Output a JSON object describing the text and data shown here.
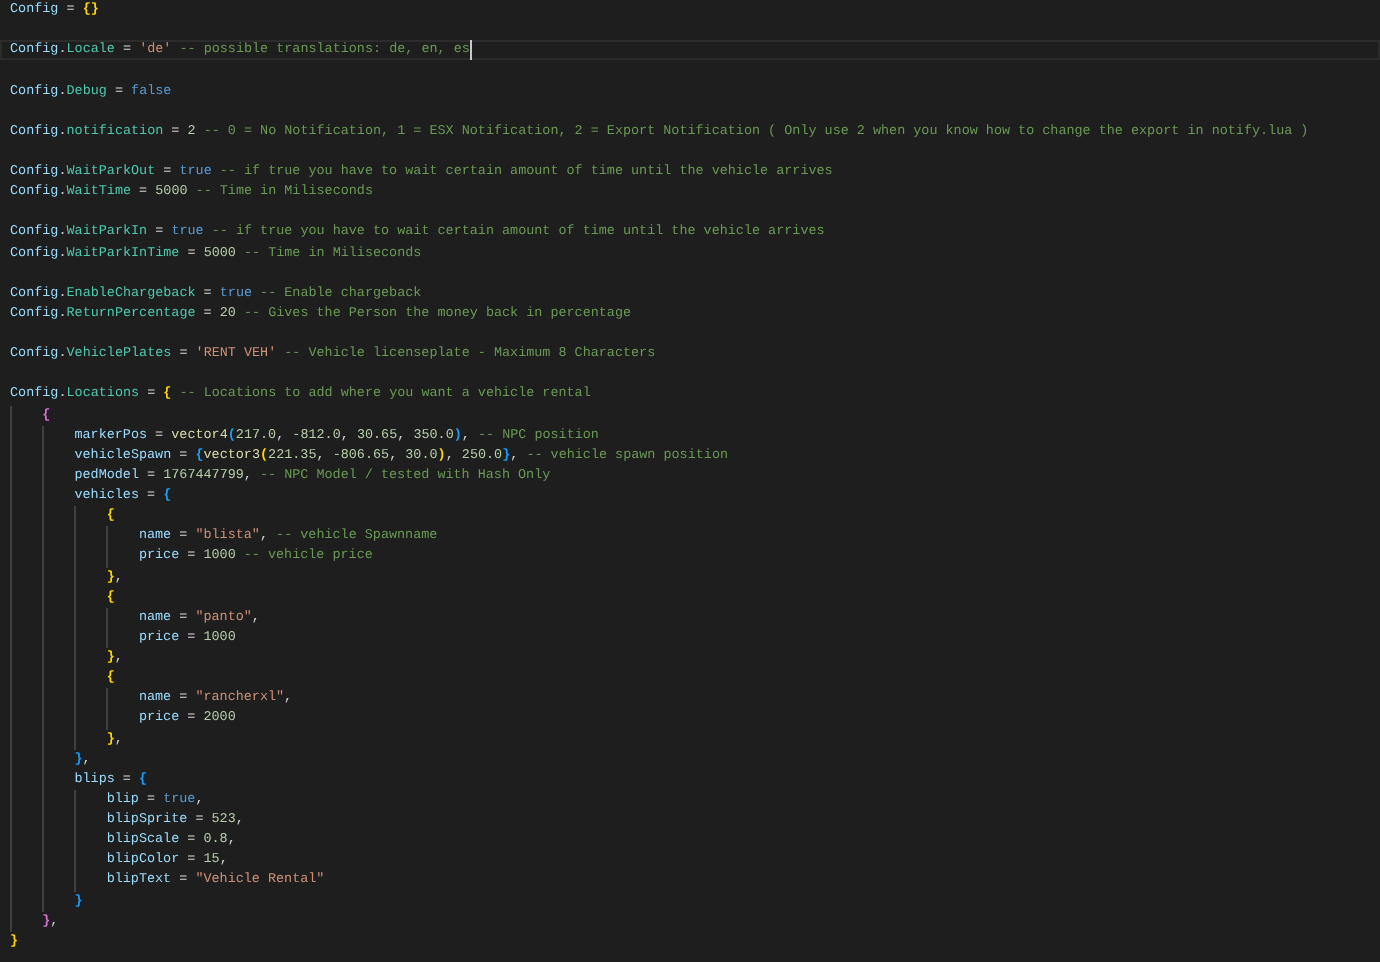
{
  "editor": {
    "lines": [
      {
        "kind": "code",
        "cursor": false,
        "tokens": [
          {
            "kind": "variable",
            "text": "Config"
          },
          {
            "kind": "operator",
            "text": " = "
          },
          {
            "kind": "bracket",
            "text": "{}",
            "color": "#ffd700"
          }
        ]
      },
      {
        "kind": "blank",
        "cursor": false
      },
      {
        "kind": "code",
        "cursor": true,
        "tokens": [
          {
            "kind": "variable",
            "text": "Config"
          },
          {
            "kind": "punctuation",
            "text": "."
          },
          {
            "kind": "field",
            "text": "Locale"
          },
          {
            "kind": "operator",
            "text": " = "
          },
          {
            "kind": "string",
            "text": "'de'"
          },
          {
            "kind": "comment",
            "text": " -- possible translations: de, en, es"
          }
        ]
      },
      {
        "kind": "blank",
        "cursor": false
      },
      {
        "kind": "code",
        "cursor": false,
        "tokens": [
          {
            "kind": "variable",
            "text": "Config"
          },
          {
            "kind": "punctuation",
            "text": "."
          },
          {
            "kind": "field",
            "text": "Debug"
          },
          {
            "kind": "operator",
            "text": " = "
          },
          {
            "kind": "keyword",
            "text": "false"
          }
        ]
      },
      {
        "kind": "blank",
        "cursor": false
      },
      {
        "kind": "code",
        "cursor": false,
        "tokens": [
          {
            "kind": "variable",
            "text": "Config"
          },
          {
            "kind": "punctuation",
            "text": "."
          },
          {
            "kind": "field",
            "text": "notification"
          },
          {
            "kind": "operator",
            "text": " = "
          },
          {
            "kind": "number",
            "text": "2"
          },
          {
            "kind": "comment",
            "text": " -- 0 = No Notification, 1 = ESX Notification, 2 = Export Notification ( Only use 2 when you know how to change the export in notify.lua )"
          }
        ]
      },
      {
        "kind": "blank",
        "cursor": false
      },
      {
        "kind": "code",
        "cursor": false,
        "tokens": [
          {
            "kind": "variable",
            "text": "Config"
          },
          {
            "kind": "punctuation",
            "text": "."
          },
          {
            "kind": "field",
            "text": "WaitParkOut"
          },
          {
            "kind": "operator",
            "text": " = "
          },
          {
            "kind": "keyword",
            "text": "true"
          },
          {
            "kind": "comment",
            "text": " -- if true you have to wait certain amount of time until the vehicle arrives"
          }
        ]
      },
      {
        "kind": "code",
        "cursor": false,
        "tokens": [
          {
            "kind": "variable",
            "text": "Config"
          },
          {
            "kind": "punctuation",
            "text": "."
          },
          {
            "kind": "field",
            "text": "WaitTime"
          },
          {
            "kind": "operator",
            "text": " = "
          },
          {
            "kind": "number",
            "text": "5000"
          },
          {
            "kind": "comment",
            "text": " -- Time in Miliseconds"
          }
        ]
      },
      {
        "kind": "blank",
        "cursor": false
      },
      {
        "kind": "code",
        "cursor": false,
        "tokens": [
          {
            "kind": "variable",
            "text": "Config"
          },
          {
            "kind": "punctuation",
            "text": "."
          },
          {
            "kind": "field",
            "text": "WaitParkIn"
          },
          {
            "kind": "operator",
            "text": " = "
          },
          {
            "kind": "keyword",
            "text": "true"
          },
          {
            "kind": "comment",
            "text": " -- if true you have to wait certain amount of time until the vehicle arrives"
          }
        ]
      },
      {
        "kind": "code",
        "cursor": false,
        "tokens": [
          {
            "kind": "variable",
            "text": "Config"
          },
          {
            "kind": "punctuation",
            "text": "."
          },
          {
            "kind": "field",
            "text": "WaitParkInTime"
          },
          {
            "kind": "operator",
            "text": " = "
          },
          {
            "kind": "number",
            "text": "5000"
          },
          {
            "kind": "comment",
            "text": " -- Time in Miliseconds"
          }
        ]
      },
      {
        "kind": "blank",
        "cursor": false
      },
      {
        "kind": "code",
        "cursor": false,
        "tokens": [
          {
            "kind": "variable",
            "text": "Config"
          },
          {
            "kind": "punctuation",
            "text": "."
          },
          {
            "kind": "field",
            "text": "EnableChargeback"
          },
          {
            "kind": "operator",
            "text": " = "
          },
          {
            "kind": "keyword",
            "text": "true"
          },
          {
            "kind": "comment",
            "text": " -- Enable chargeback"
          }
        ]
      },
      {
        "kind": "code",
        "cursor": false,
        "tokens": [
          {
            "kind": "variable",
            "text": "Config"
          },
          {
            "kind": "punctuation",
            "text": "."
          },
          {
            "kind": "field",
            "text": "ReturnPercentage"
          },
          {
            "kind": "operator",
            "text": " = "
          },
          {
            "kind": "number",
            "text": "20"
          },
          {
            "kind": "comment",
            "text": " -- Gives the Person the money back in percentage"
          }
        ]
      },
      {
        "kind": "blank",
        "cursor": false
      },
      {
        "kind": "code",
        "cursor": false,
        "tokens": [
          {
            "kind": "variable",
            "text": "Config"
          },
          {
            "kind": "punctuation",
            "text": "."
          },
          {
            "kind": "field",
            "text": "VehiclePlates"
          },
          {
            "kind": "operator",
            "text": " = "
          },
          {
            "kind": "string",
            "text": "'RENT VEH'"
          },
          {
            "kind": "comment",
            "text": " -- Vehicle licenseplate - Maximum 8 Characters"
          }
        ]
      },
      {
        "kind": "blank",
        "cursor": false
      },
      {
        "kind": "code",
        "cursor": false,
        "tokens": [
          {
            "kind": "variable",
            "text": "Config"
          },
          {
            "kind": "punctuation",
            "text": "."
          },
          {
            "kind": "field",
            "text": "Locations"
          },
          {
            "kind": "operator",
            "text": " = "
          },
          {
            "kind": "bracket",
            "text": "{",
            "color": "#ffd700"
          },
          {
            "kind": "comment",
            "text": " -- Locations to add where you want a vehicle rental"
          }
        ],
        "children": [
          {
            "kind": "code",
            "cursor": false,
            "tokens": [
              {
                "kind": "bracket",
                "text": "{",
                "color": "#da70d6"
              }
            ],
            "children": [
              {
                "kind": "code",
                "cursor": false,
                "tokens": [
                  {
                    "kind": "property",
                    "text": "markerPos"
                  },
                  {
                    "kind": "operator",
                    "text": " = "
                  },
                  {
                    "kind": "function",
                    "text": "vector4"
                  },
                  {
                    "kind": "bracket",
                    "text": "(",
                    "color": "#179fff"
                  },
                  {
                    "kind": "number",
                    "text": "217.0"
                  },
                  {
                    "kind": "punctuation",
                    "text": ", "
                  },
                  {
                    "kind": "number",
                    "text": "-812.0"
                  },
                  {
                    "kind": "punctuation",
                    "text": ", "
                  },
                  {
                    "kind": "number",
                    "text": "30.65"
                  },
                  {
                    "kind": "punctuation",
                    "text": ", "
                  },
                  {
                    "kind": "number",
                    "text": "350.0"
                  },
                  {
                    "kind": "bracket",
                    "text": ")",
                    "color": "#179fff"
                  },
                  {
                    "kind": "punctuation",
                    "text": ","
                  },
                  {
                    "kind": "comment",
                    "text": " -- NPC position"
                  }
                ]
              },
              {
                "kind": "code",
                "cursor": false,
                "tokens": [
                  {
                    "kind": "property",
                    "text": "vehicleSpawn"
                  },
                  {
                    "kind": "operator",
                    "text": " = "
                  },
                  {
                    "kind": "bracket",
                    "text": "{",
                    "color": "#179fff"
                  },
                  {
                    "kind": "function",
                    "text": "vector3"
                  },
                  {
                    "kind": "bracket",
                    "text": "(",
                    "color": "#ffd700"
                  },
                  {
                    "kind": "number",
                    "text": "221.35"
                  },
                  {
                    "kind": "punctuation",
                    "text": ", "
                  },
                  {
                    "kind": "number",
                    "text": "-806.65"
                  },
                  {
                    "kind": "punctuation",
                    "text": ", "
                  },
                  {
                    "kind": "number",
                    "text": "30.0"
                  },
                  {
                    "kind": "bracket",
                    "text": ")",
                    "color": "#ffd700"
                  },
                  {
                    "kind": "punctuation",
                    "text": ", "
                  },
                  {
                    "kind": "number",
                    "text": "250.0"
                  },
                  {
                    "kind": "bracket",
                    "text": "}",
                    "color": "#179fff"
                  },
                  {
                    "kind": "punctuation",
                    "text": ","
                  },
                  {
                    "kind": "comment",
                    "text": " -- vehicle spawn position"
                  }
                ]
              },
              {
                "kind": "code",
                "cursor": false,
                "tokens": [
                  {
                    "kind": "property",
                    "text": "pedModel"
                  },
                  {
                    "kind": "operator",
                    "text": " = "
                  },
                  {
                    "kind": "number",
                    "text": "1767447799"
                  },
                  {
                    "kind": "punctuation",
                    "text": ","
                  },
                  {
                    "kind": "comment",
                    "text": " -- NPC Model / tested with Hash Only"
                  }
                ]
              },
              {
                "kind": "code",
                "cursor": false,
                "tokens": [
                  {
                    "kind": "property",
                    "text": "vehicles"
                  },
                  {
                    "kind": "operator",
                    "text": " = "
                  },
                  {
                    "kind": "bracket",
                    "text": "{",
                    "color": "#179fff"
                  }
                ],
                "children": [
                  {
                    "kind": "code",
                    "cursor": false,
                    "tokens": [
                      {
                        "kind": "bracket",
                        "text": "{",
                        "color": "#ffd700"
                      }
                    ],
                    "children": [
                      {
                        "kind": "code",
                        "cursor": false,
                        "tokens": [
                          {
                            "kind": "property",
                            "text": "name"
                          },
                          {
                            "kind": "operator",
                            "text": " = "
                          },
                          {
                            "kind": "string",
                            "text": "\"blista\""
                          },
                          {
                            "kind": "punctuation",
                            "text": ","
                          },
                          {
                            "kind": "comment",
                            "text": " -- vehicle Spawnname"
                          }
                        ]
                      },
                      {
                        "kind": "code",
                        "cursor": false,
                        "tokens": [
                          {
                            "kind": "property",
                            "text": "price"
                          },
                          {
                            "kind": "operator",
                            "text": " = "
                          },
                          {
                            "kind": "number",
                            "text": "1000"
                          },
                          {
                            "kind": "comment",
                            "text": " -- vehicle price"
                          }
                        ]
                      }
                    ]
                  },
                  {
                    "kind": "code",
                    "cursor": false,
                    "tokens": [
                      {
                        "kind": "bracket",
                        "text": "}",
                        "color": "#ffd700"
                      },
                      {
                        "kind": "punctuation",
                        "text": ","
                      }
                    ]
                  },
                  {
                    "kind": "code",
                    "cursor": false,
                    "tokens": [
                      {
                        "kind": "bracket",
                        "text": "{",
                        "color": "#ffd700"
                      }
                    ],
                    "children": [
                      {
                        "kind": "code",
                        "cursor": false,
                        "tokens": [
                          {
                            "kind": "property",
                            "text": "name"
                          },
                          {
                            "kind": "operator",
                            "text": " = "
                          },
                          {
                            "kind": "string",
                            "text": "\"panto\""
                          },
                          {
                            "kind": "punctuation",
                            "text": ","
                          }
                        ]
                      },
                      {
                        "kind": "code",
                        "cursor": false,
                        "tokens": [
                          {
                            "kind": "property",
                            "text": "price"
                          },
                          {
                            "kind": "operator",
                            "text": " = "
                          },
                          {
                            "kind": "number",
                            "text": "1000"
                          }
                        ]
                      }
                    ]
                  },
                  {
                    "kind": "code",
                    "cursor": false,
                    "tokens": [
                      {
                        "kind": "bracket",
                        "text": "}",
                        "color": "#ffd700"
                      },
                      {
                        "kind": "punctuation",
                        "text": ","
                      }
                    ]
                  },
                  {
                    "kind": "code",
                    "cursor": false,
                    "tokens": [
                      {
                        "kind": "bracket",
                        "text": "{",
                        "color": "#ffd700"
                      }
                    ],
                    "children": [
                      {
                        "kind": "code",
                        "cursor": false,
                        "tokens": [
                          {
                            "kind": "property",
                            "text": "name"
                          },
                          {
                            "kind": "operator",
                            "text": " = "
                          },
                          {
                            "kind": "string",
                            "text": "\"rancherxl\""
                          },
                          {
                            "kind": "punctuation",
                            "text": ","
                          }
                        ]
                      },
                      {
                        "kind": "code",
                        "cursor": false,
                        "tokens": [
                          {
                            "kind": "property",
                            "text": "price"
                          },
                          {
                            "kind": "operator",
                            "text": " = "
                          },
                          {
                            "kind": "number",
                            "text": "2000"
                          }
                        ]
                      }
                    ]
                  },
                  {
                    "kind": "code",
                    "cursor": false,
                    "tokens": [
                      {
                        "kind": "bracket",
                        "text": "}",
                        "color": "#ffd700"
                      },
                      {
                        "kind": "punctuation",
                        "text": ","
                      }
                    ]
                  }
                ]
              },
              {
                "kind": "code",
                "cursor": false,
                "tokens": [
                  {
                    "kind": "bracket",
                    "text": "}",
                    "color": "#179fff"
                  },
                  {
                    "kind": "punctuation",
                    "text": ","
                  }
                ]
              },
              {
                "kind": "code",
                "cursor": false,
                "tokens": [
                  {
                    "kind": "property",
                    "text": "blips"
                  },
                  {
                    "kind": "operator",
                    "text": " = "
                  },
                  {
                    "kind": "bracket",
                    "text": "{",
                    "color": "#179fff"
                  }
                ],
                "children": [
                  {
                    "kind": "code",
                    "cursor": false,
                    "tokens": [
                      {
                        "kind": "property",
                        "text": "blip"
                      },
                      {
                        "kind": "operator",
                        "text": " = "
                      },
                      {
                        "kind": "keyword",
                        "text": "true"
                      },
                      {
                        "kind": "punctuation",
                        "text": ","
                      }
                    ]
                  },
                  {
                    "kind": "code",
                    "cursor": false,
                    "tokens": [
                      {
                        "kind": "property",
                        "text": "blipSprite"
                      },
                      {
                        "kind": "operator",
                        "text": " = "
                      },
                      {
                        "kind": "number",
                        "text": "523"
                      },
                      {
                        "kind": "punctuation",
                        "text": ","
                      }
                    ]
                  },
                  {
                    "kind": "code",
                    "cursor": false,
                    "tokens": [
                      {
                        "kind": "property",
                        "text": "blipScale"
                      },
                      {
                        "kind": "operator",
                        "text": " = "
                      },
                      {
                        "kind": "number",
                        "text": "0.8"
                      },
                      {
                        "kind": "punctuation",
                        "text": ","
                      }
                    ]
                  },
                  {
                    "kind": "code",
                    "cursor": false,
                    "tokens": [
                      {
                        "kind": "property",
                        "text": "blipColor"
                      },
                      {
                        "kind": "operator",
                        "text": " = "
                      },
                      {
                        "kind": "number",
                        "text": "15"
                      },
                      {
                        "kind": "punctuation",
                        "text": ","
                      }
                    ]
                  },
                  {
                    "kind": "code",
                    "cursor": false,
                    "tokens": [
                      {
                        "kind": "property",
                        "text": "blipText"
                      },
                      {
                        "kind": "operator",
                        "text": " = "
                      },
                      {
                        "kind": "string",
                        "text": "\"Vehicle Rental\""
                      }
                    ]
                  }
                ]
              },
              {
                "kind": "code",
                "cursor": false,
                "tokens": [
                  {
                    "kind": "bracket",
                    "text": "}",
                    "color": "#179fff"
                  }
                ]
              }
            ]
          },
          {
            "kind": "code",
            "cursor": false,
            "tokens": [
              {
                "kind": "bracket",
                "text": "}",
                "color": "#da70d6"
              },
              {
                "kind": "punctuation",
                "text": ","
              }
            ]
          }
        ]
      },
      {
        "kind": "code",
        "cursor": false,
        "tokens": [
          {
            "kind": "bracket",
            "text": "}",
            "color": "#ffd700"
          }
        ]
      }
    ]
  }
}
